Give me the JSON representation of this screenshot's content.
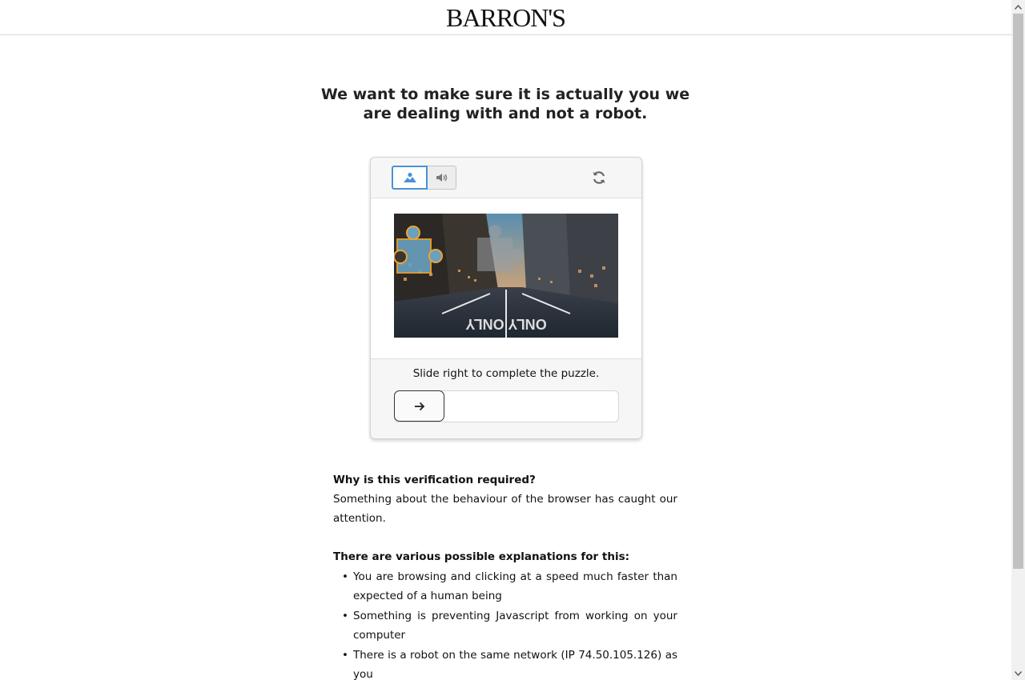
{
  "header": {
    "logo_text": "BARRON'S"
  },
  "main": {
    "title": "We want to make sure it is actually you we are dealing with and not a robot."
  },
  "captcha": {
    "modes": [
      {
        "icon": "image-icon",
        "active": true
      },
      {
        "icon": "speaker-icon",
        "active": false
      }
    ],
    "refresh_icon": "refresh-icon",
    "instruction": "Slide right to complete the puzzle.",
    "slider_icon": "arrow-right-icon",
    "image_text": "ONLY ONLY",
    "accent_color": "#4a90d9"
  },
  "explanation": {
    "q1": "Why is this verification required?",
    "a1": "Something about the behaviour of the browser has caught our attention.",
    "q2": "There are various possible explanations for this:",
    "reasons": [
      "You are browsing and clicking at a speed much faster than expected of a human being",
      "Something is preventing Javascript from working on your computer",
      "There is a robot on the same network (IP 74.50.105.126) as you"
    ]
  }
}
